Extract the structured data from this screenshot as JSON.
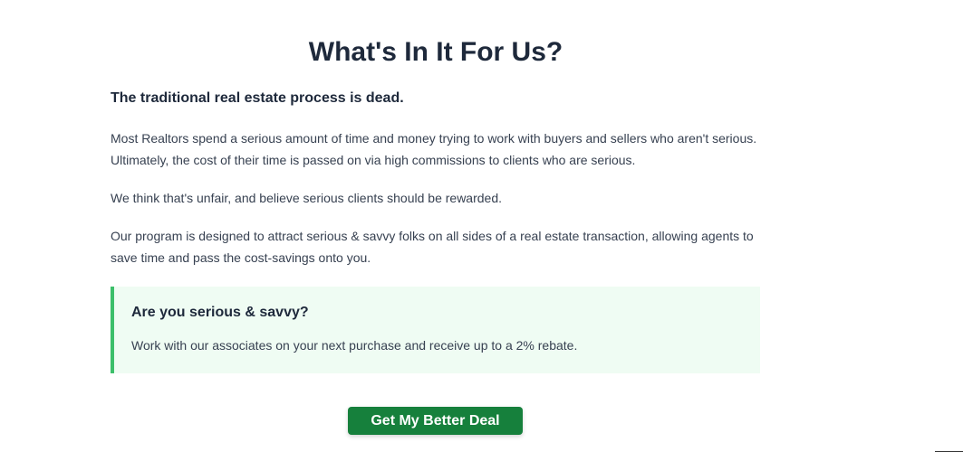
{
  "page": {
    "title": "What's In It For Us?",
    "subtitle": "The traditional real estate process is dead.",
    "paragraphs": [
      "Most Realtors spend a serious amount of time and money trying to work with buyers and sellers who aren't serious. Ultimately, the cost of their time is passed on via high commissions to clients who are serious.",
      "We think that's unfair, and believe serious clients should be rewarded.",
      "Our program is designed to attract serious & savvy folks on all sides of a real estate transaction, allowing agents to save time and pass the cost-savings onto you."
    ]
  },
  "callout": {
    "title": "Are you serious & savvy?",
    "text": "Work with our associates on your next purchase and receive up to a 2% rebate."
  },
  "cta": {
    "label": "Get My Better Deal"
  },
  "colors": {
    "heading": "#1e293b",
    "body_text": "#374151",
    "callout_background": "#effcf3",
    "callout_border": "#3cbf6a",
    "button_background": "#16803c",
    "button_text": "#ffffff"
  }
}
